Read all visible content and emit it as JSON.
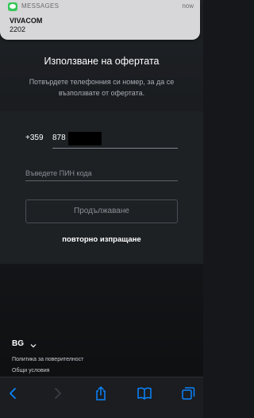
{
  "notification": {
    "app": "MESSAGES",
    "time": "now",
    "sender": "VIVACOM",
    "body": "2202"
  },
  "header": {
    "title": "Използване на офертата",
    "subtitle": "Потвърдете телефонния си номер, за да се възползвате от офертата."
  },
  "form": {
    "country_code": "+359",
    "phone_value": "878",
    "pin_placeholder": "Въведете ПИН кода",
    "continue_label": "Продължаване",
    "resend_label": "повторно изпращане"
  },
  "footer": {
    "language": "BG",
    "privacy_link": "Политика за поверителност",
    "terms_link": "Общи условия"
  },
  "toolbar": {
    "icons": [
      "back-icon",
      "forward-icon",
      "share-icon",
      "bookmarks-icon",
      "tabs-icon"
    ]
  },
  "colors": {
    "accent": "#0a84ff",
    "background": "#15171a",
    "card": "#1e2124"
  }
}
